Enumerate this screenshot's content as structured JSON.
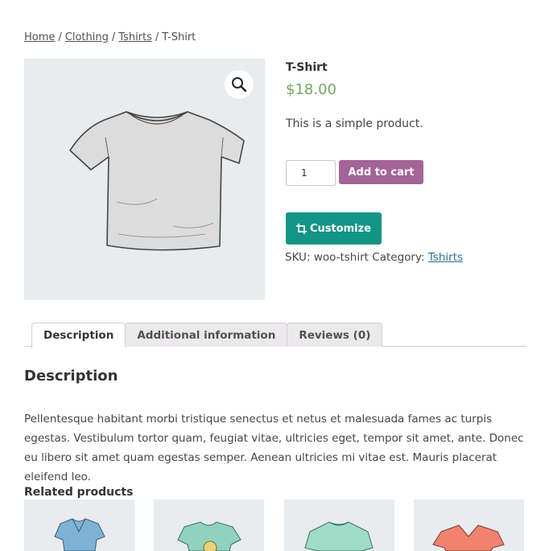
{
  "breadcrumb": {
    "home": "Home",
    "clothing": "Clothing",
    "tshirts": "Tshirts",
    "separator": "/",
    "current": "T-Shirt"
  },
  "gallery": {
    "zoom_icon": "magnifier-icon"
  },
  "product": {
    "title": "T-Shirt",
    "price": "$18.00",
    "short_description": "This is a simple product.",
    "quantity": "1",
    "add_to_cart_label": "Add to cart",
    "customize_label": "Customize",
    "customize_icon": "crop-icon",
    "meta": {
      "sku_label": "SKU:",
      "sku": "woo-tshirt",
      "category_label": "Category:",
      "category": "Tshirts"
    }
  },
  "tabs": [
    {
      "label": "Description",
      "active": true
    },
    {
      "label": "Additional information",
      "active": false
    },
    {
      "label": "Reviews (0)",
      "active": false
    }
  ],
  "description": {
    "heading": "Description",
    "body": "Pellentesque habitant morbi tristique senectus et netus et malesuada fames ac turpis egestas. Vestibulum tortor quam, feugiat vitae, ultricies eget, tempor sit amet, ante. Donec eu libero sit amet quam egestas semper. Aenean ultricies mi vitae est. Mauris placerat eleifend leo."
  },
  "related": {
    "heading": "Related products",
    "items": [
      {
        "color": "#7fb3d5"
      },
      {
        "color": "#8fd3bf"
      },
      {
        "color": "#9fdcc7"
      },
      {
        "color": "#f0826e"
      }
    ]
  },
  "colors": {
    "price": "#77a464",
    "add_to_cart": "#a46497",
    "customize": "#139585",
    "link": "#2a6e9b"
  }
}
